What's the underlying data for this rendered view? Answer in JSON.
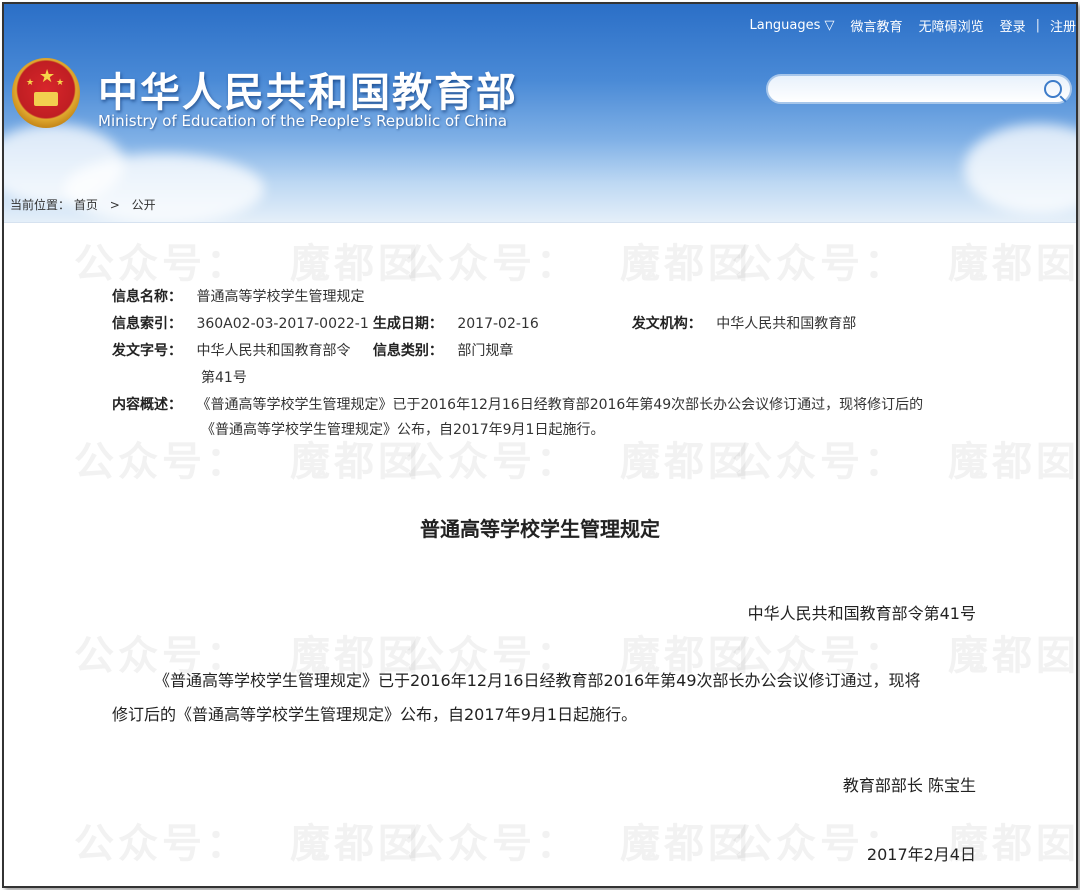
{
  "header": {
    "top_nav": [
      "Languages ▽",
      "微言教育",
      "无障碍浏览",
      "登录",
      "|",
      "注册"
    ],
    "site_title": "中华人民共和国教育部",
    "site_subtitle": "Ministry of Education of the People's Republic of China",
    "search": {
      "value": "",
      "placeholder": ""
    }
  },
  "breadcrumb": {
    "label": "当前位置：",
    "home": "首页",
    "separator": ">",
    "current": "公开"
  },
  "meta": {
    "name_key": "信息名称：",
    "name_value": "普通高等学校学生管理规定",
    "index_key": "信息索引：",
    "index_value": "360A02-03-2017-0022-1",
    "date_key": "生成日期：",
    "date_value": "2017-02-16",
    "org_key": "发文机构：",
    "org_value": "中华人民共和国教育部",
    "docno_key": "发文字号：",
    "docno_value_line1": "中华人民共和国教育部令",
    "docno_value_line2": "第41号",
    "category_key": "信息类别：",
    "category_value": "部门规章",
    "summary_key": "内容概述：",
    "summary_line1": "《普通高等学校学生管理规定》已于2016年12月16日经教育部2016年第49次部长办公会议修订通过，现将修订后的",
    "summary_line2": "《普通高等学校学生管理规定》公布，自2017年9月1日起施行。"
  },
  "document": {
    "title": "普通高等学校学生管理规定",
    "order_no": "中华人民共和国教育部令第41号",
    "body_line1": "《普通高等学校学生管理规定》已于2016年12月16日经教育部2016年第49次部长办公会议修订通过，现将",
    "body_line2": "修订后的《普通高等学校学生管理规定》公布，自2017年9月1日起施行。",
    "signer": "教育部部长 陈宝生",
    "date": "2017年2月4日"
  },
  "watermark": {
    "text_a": "公众号：",
    "text_b": "魔都囡"
  },
  "colors": {
    "header_blue": "#2b6fc7",
    "emblem_red": "#c01e23",
    "emblem_gold": "#e0a92f"
  }
}
